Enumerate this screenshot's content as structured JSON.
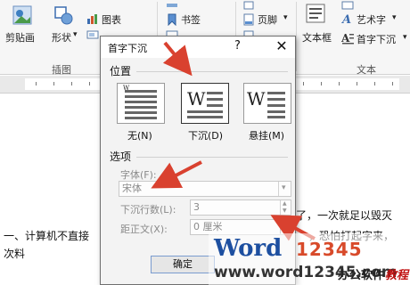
{
  "ribbon": {
    "clipart_label": "剪贴画",
    "shapes_label": "形状",
    "shapes_arrow": "▾",
    "chart_label": "图表",
    "bookmark_label": "书签",
    "footer_label": "页脚",
    "footer_arrow": "▾",
    "textbox_label": "文本框",
    "wordart_label": "艺术字",
    "wordart_arrow": "▾",
    "dropcap_label": "首字下沉",
    "dropcap_arrow": "▾",
    "group_illustrations": "插图",
    "group_text": "文本"
  },
  "document": {
    "line1_right": "了，一次就足以毁灭",
    "line2_left": "一、计算机不直接",
    "line2_right": "，恐怕打起字来，",
    "line3_left": "次料"
  },
  "dialog": {
    "title": "首字下沉",
    "help": "?",
    "close": "✕",
    "position_heading": "位置",
    "positions": [
      {
        "label": "无(N)"
      },
      {
        "label": "下沉(D)"
      },
      {
        "label": "悬挂(M)"
      }
    ],
    "options_heading": "选项",
    "font_label": "字体(F):",
    "font_value": "宋体",
    "font_arrow": "▾",
    "lines_label": "下沉行数(L):",
    "lines_value": "3",
    "distance_label": "距正文(X):",
    "distance_value": "0 厘米",
    "ok_label": "确定"
  },
  "watermark": {
    "brand_word": "Word",
    "brand_digits": "12345",
    "url": "www.word12345.com",
    "cn_text": "办公软件",
    "cn_text2": "教程"
  },
  "colors": {
    "arrow": "#d9412f",
    "ok_border": "#7a9ccf"
  }
}
